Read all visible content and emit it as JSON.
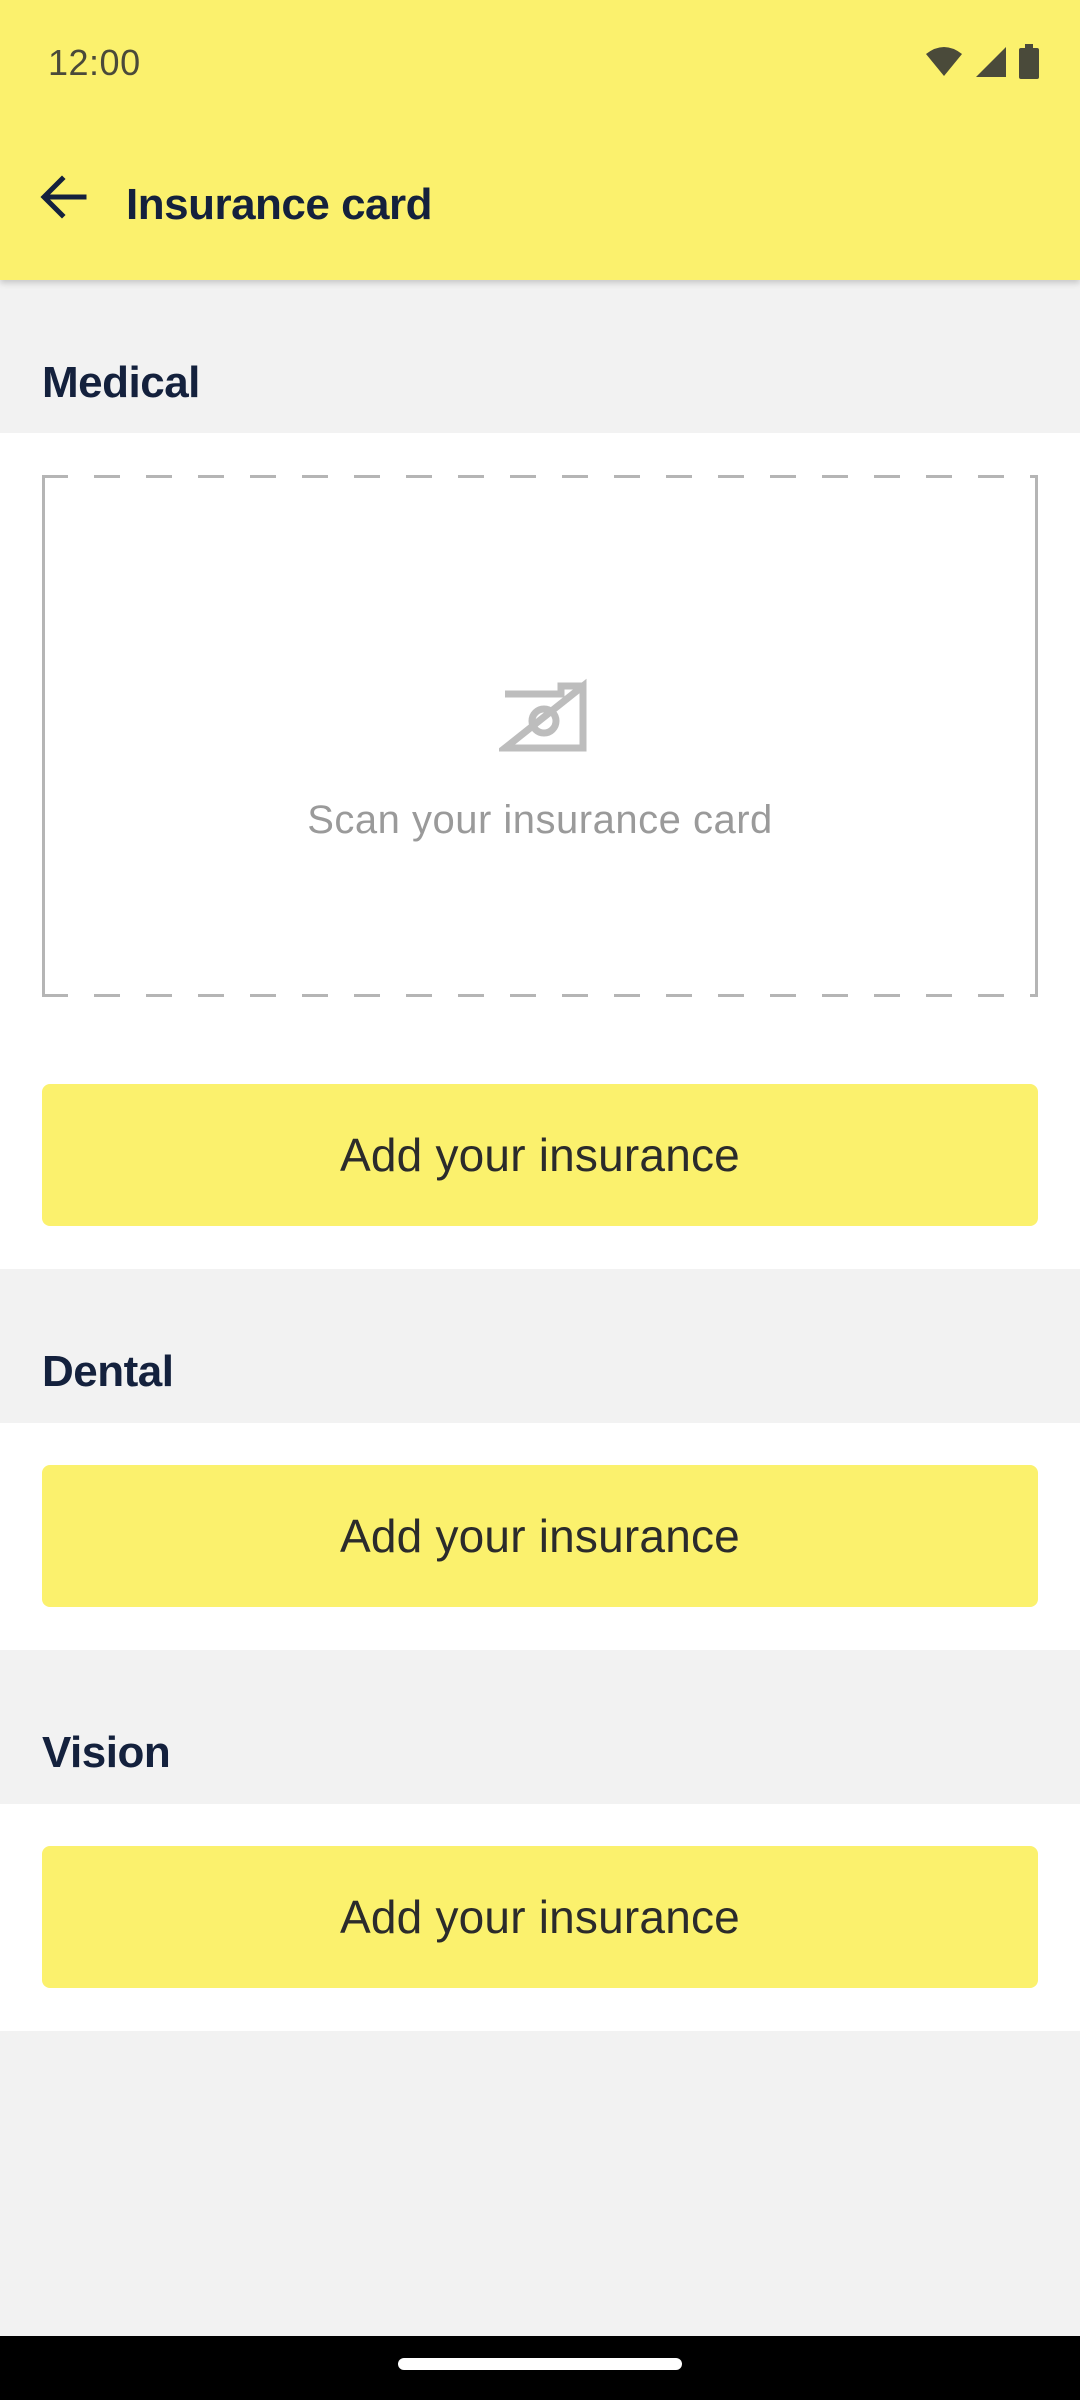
{
  "status_bar": {
    "time": "12:00",
    "icons": [
      "wifi-icon",
      "signal-icon",
      "battery-icon"
    ]
  },
  "app_bar": {
    "back_icon": "arrow-left-icon",
    "title": "Insurance card"
  },
  "sections": {
    "medical": {
      "title": "Medical",
      "scan_icon": "camera-icon",
      "scan_text": "Scan your insurance card",
      "button_label": "Add your insurance"
    },
    "dental": {
      "title": "Dental",
      "button_label": "Add your insurance"
    },
    "vision": {
      "title": "Vision",
      "button_label": "Add your insurance"
    }
  },
  "colors": {
    "accent_yellow": "#fbf16d",
    "heading_navy": "#14213d",
    "background_gray": "#f2f2f2"
  }
}
